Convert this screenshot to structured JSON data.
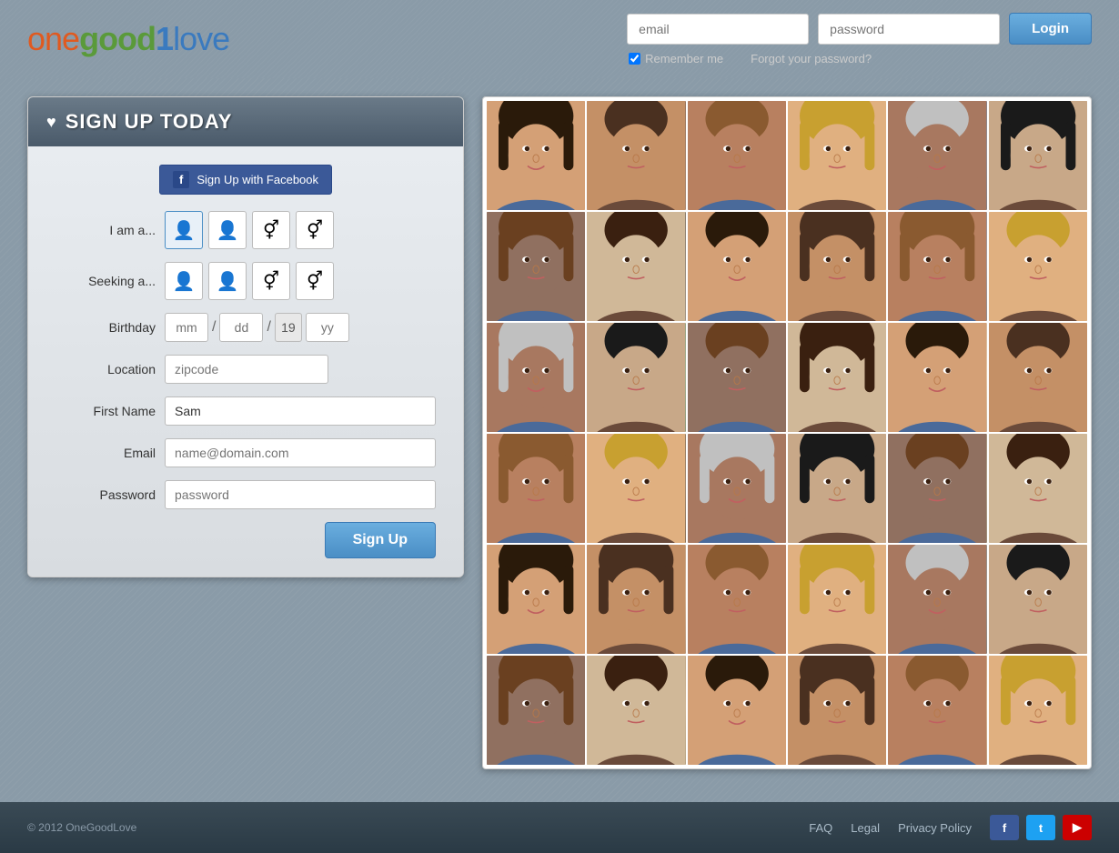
{
  "site": {
    "logo": {
      "one": "one",
      "good": "good",
      "l": "l",
      "ove": "ove",
      "one_num": "1"
    },
    "title": "OneGoodLove"
  },
  "header": {
    "email_placeholder": "email",
    "password_placeholder": "password",
    "login_label": "Login",
    "remember_label": "Remember me",
    "forgot_label": "Forgot your password?"
  },
  "signup": {
    "title": "SIGN UP TODAY",
    "heart": "♥",
    "facebook_btn": "Sign Up with Facebook",
    "facebook_f": "f",
    "iam_label": "I am a...",
    "seeking_label": "Seeking a...",
    "birthday_label": "Birthday",
    "birthday_mm": "mm",
    "birthday_dd": "dd",
    "birthday_19": "19",
    "birthday_yy": "yy",
    "location_label": "Location",
    "location_placeholder": "zipcode",
    "firstname_label": "First Name",
    "firstname_value": "Sam",
    "email_label": "Email",
    "email_placeholder": "name@domain.com",
    "password_label": "Password",
    "password_placeholder": "password",
    "signup_btn": "Sign Up"
  },
  "footer": {
    "copyright": "© 2012 OneGoodLove",
    "faq": "FAQ",
    "legal": "Legal",
    "privacy": "Privacy Policy",
    "facebook_icon": "f",
    "twitter_icon": "t",
    "youtube_icon": "▶"
  },
  "photos": {
    "count": 36,
    "classes": [
      "p1",
      "p2",
      "p3",
      "p4",
      "p5",
      "p6",
      "p7",
      "p8",
      "p9",
      "p10",
      "p11",
      "p12",
      "p13",
      "p14",
      "p15",
      "p16",
      "p17",
      "p18",
      "p19",
      "p20",
      "p21",
      "p22",
      "p23",
      "p24",
      "p25",
      "p26",
      "p27",
      "p28",
      "p29",
      "p30",
      "p31",
      "p32",
      "p33",
      "p34",
      "p35",
      "p36"
    ]
  }
}
